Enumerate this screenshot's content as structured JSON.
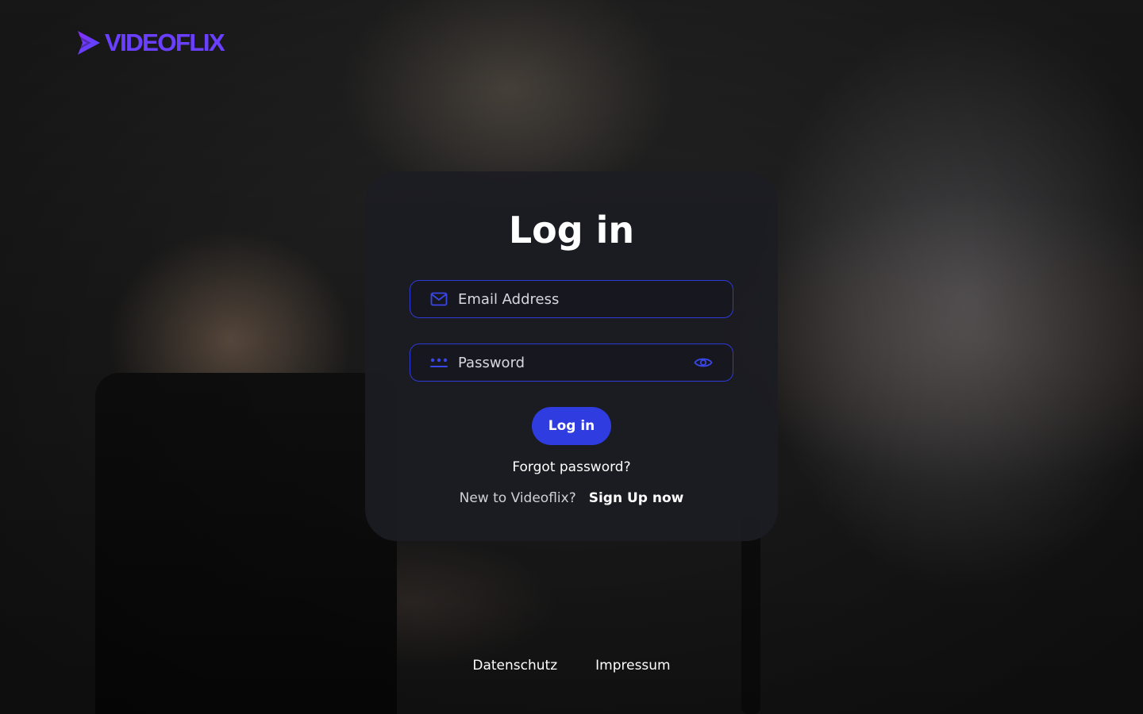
{
  "brand": {
    "name": "VIDEOFLIX",
    "accent_color": "#6a3fff",
    "icon": "play-chevron-icon"
  },
  "login": {
    "title": "Log in",
    "email": {
      "placeholder": "Email Address",
      "value": "",
      "icon": "mail-icon"
    },
    "password": {
      "placeholder": "Password",
      "value": "",
      "icon": "password-dots-icon",
      "toggle_icon": "eye-icon"
    },
    "submit_label": "Log in",
    "forgot_label": "Forgot password?",
    "signup_question": "New to Videoflix?",
    "signup_link": "Sign Up now",
    "button_color": "#2f3de0",
    "field_border_color": "#2e3ad8"
  },
  "footer": {
    "links": [
      "Datenschutz",
      "Impressum"
    ]
  }
}
